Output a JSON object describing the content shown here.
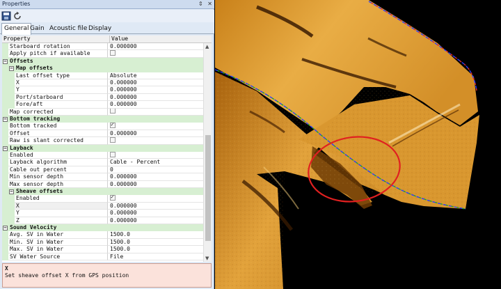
{
  "panel": {
    "title": "Properties",
    "title_icons": [
      "pin-icon",
      "close-icon"
    ],
    "tabs": [
      {
        "label": "General",
        "active": true
      },
      {
        "label": "Gain",
        "active": false
      },
      {
        "label": "Acoustic file",
        "active": false
      },
      {
        "label": "Display",
        "active": false
      }
    ],
    "columns": {
      "property": "Property",
      "value": "Value"
    }
  },
  "rows": [
    {
      "kind": "prop",
      "level": 0,
      "name": "Starboard rotation",
      "value": "0.000000"
    },
    {
      "kind": "prop",
      "level": 0,
      "name": "Apply pitch if available",
      "check": false
    },
    {
      "kind": "cat",
      "level": 0,
      "name": "Offsets"
    },
    {
      "kind": "cat",
      "level": 1,
      "name": "Map offsets"
    },
    {
      "kind": "prop",
      "level": 1,
      "name": "Last offset type",
      "value": "Absolute"
    },
    {
      "kind": "prop",
      "level": 1,
      "name": "X",
      "value": "0.000000"
    },
    {
      "kind": "prop",
      "level": 1,
      "name": "Y",
      "value": "0.000000"
    },
    {
      "kind": "prop",
      "level": 1,
      "name": "Port/starboard",
      "value": "0.000000"
    },
    {
      "kind": "prop",
      "level": 1,
      "name": "Fore/aft",
      "value": "0.000000"
    },
    {
      "kind": "prop",
      "level": 0,
      "name": "Map corrected",
      "check": false
    },
    {
      "kind": "cat",
      "level": 0,
      "name": "Bottom tracking"
    },
    {
      "kind": "prop",
      "level": 0,
      "name": "Bottom tracked",
      "check": true
    },
    {
      "kind": "prop",
      "level": 0,
      "name": "Offset",
      "value": "0.000000"
    },
    {
      "kind": "prop",
      "level": 0,
      "name": "Raw is slant corrected",
      "check": false
    },
    {
      "kind": "cat",
      "level": 0,
      "name": "Layback"
    },
    {
      "kind": "prop",
      "level": 0,
      "name": "Enabled",
      "check": false
    },
    {
      "kind": "prop",
      "level": 0,
      "name": "Layback algorithm",
      "value": "Cable - Percent"
    },
    {
      "kind": "prop",
      "level": 0,
      "name": "Cable out percent",
      "value": "0"
    },
    {
      "kind": "prop",
      "level": 0,
      "name": "Min sensor depth",
      "value": "0.000000"
    },
    {
      "kind": "prop",
      "level": 0,
      "name": "Max sensor depth",
      "value": "0.000000"
    },
    {
      "kind": "cat",
      "level": 1,
      "name": "Sheave offsets"
    },
    {
      "kind": "prop",
      "level": 1,
      "name": "Enabled",
      "check": true
    },
    {
      "kind": "prop",
      "level": 1,
      "name": "X",
      "value": "0.000000",
      "selected": true
    },
    {
      "kind": "prop",
      "level": 1,
      "name": "Y",
      "value": "0.000000"
    },
    {
      "kind": "prop",
      "level": 1,
      "name": "Z",
      "value": "0.000000"
    },
    {
      "kind": "cat",
      "level": 0,
      "name": "Sound Velocity"
    },
    {
      "kind": "prop",
      "level": 0,
      "name": "Avg. SV in Water",
      "value": "1500.0"
    },
    {
      "kind": "prop",
      "level": 0,
      "name": "Min. SV in Water",
      "value": "1500.0"
    },
    {
      "kind": "prop",
      "level": 0,
      "name": "Max. SV in Water",
      "value": "1500.0"
    },
    {
      "kind": "prop",
      "level": 0,
      "name": "SV Water Source",
      "value": "File"
    }
  ],
  "description": {
    "title": "X",
    "text": "Set sheave offset X from GPS position"
  },
  "colors": {
    "category_bg": "#d7efd2",
    "description_bg": "#fbe2db",
    "sonar_bright": "#e0a43a",
    "sonar_dark": "#7a4406",
    "highlight_ring": "#e02020",
    "track_blue": "#2a3cff",
    "track_red": "#e02a2a",
    "track_green": "#1fa52a"
  }
}
